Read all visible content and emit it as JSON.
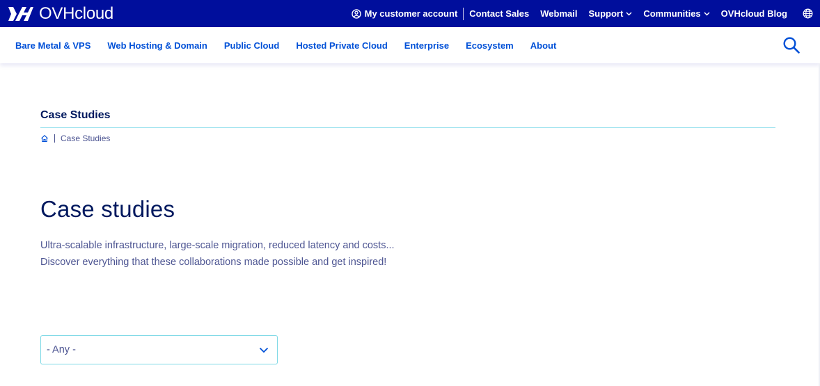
{
  "brand": {
    "name": "OVHcloud"
  },
  "topbar": {
    "links": [
      {
        "label": "My customer account",
        "icon": "user-circle-icon"
      },
      {
        "label": "Contact Sales"
      },
      {
        "label": "Webmail"
      },
      {
        "label": "Support",
        "icon": "chevron-down-icon"
      },
      {
        "label": "Communities",
        "icon": "chevron-down-icon"
      },
      {
        "label": "OVHcloud Blog"
      }
    ],
    "language_icon": "globe-icon"
  },
  "nav": {
    "items": [
      {
        "label": "Bare Metal & VPS"
      },
      {
        "label": "Web Hosting & Domain"
      },
      {
        "label": "Public Cloud"
      },
      {
        "label": "Hosted Private Cloud"
      },
      {
        "label": "Enterprise"
      },
      {
        "label": "Ecosystem"
      },
      {
        "label": "About"
      }
    ],
    "search_icon": "search-icon"
  },
  "section": {
    "title": "Case Studies",
    "breadcrumb": {
      "home_icon": "home-icon",
      "current": "Case Studies"
    }
  },
  "main": {
    "title": "Case studies",
    "intro_line1": "Ultra-scalable infrastructure, large-scale migration, reduced latency and costs...",
    "intro_line2": "Discover everything that these collaborations made possible and get inspired!"
  },
  "filter": {
    "selected": "- Any -"
  },
  "colors": {
    "topbar_bg": "#000e9c",
    "nav_link": "#0050d7",
    "heading": "#00185e",
    "body_text": "#4d5592",
    "accent_line": "#7fd9e6"
  }
}
